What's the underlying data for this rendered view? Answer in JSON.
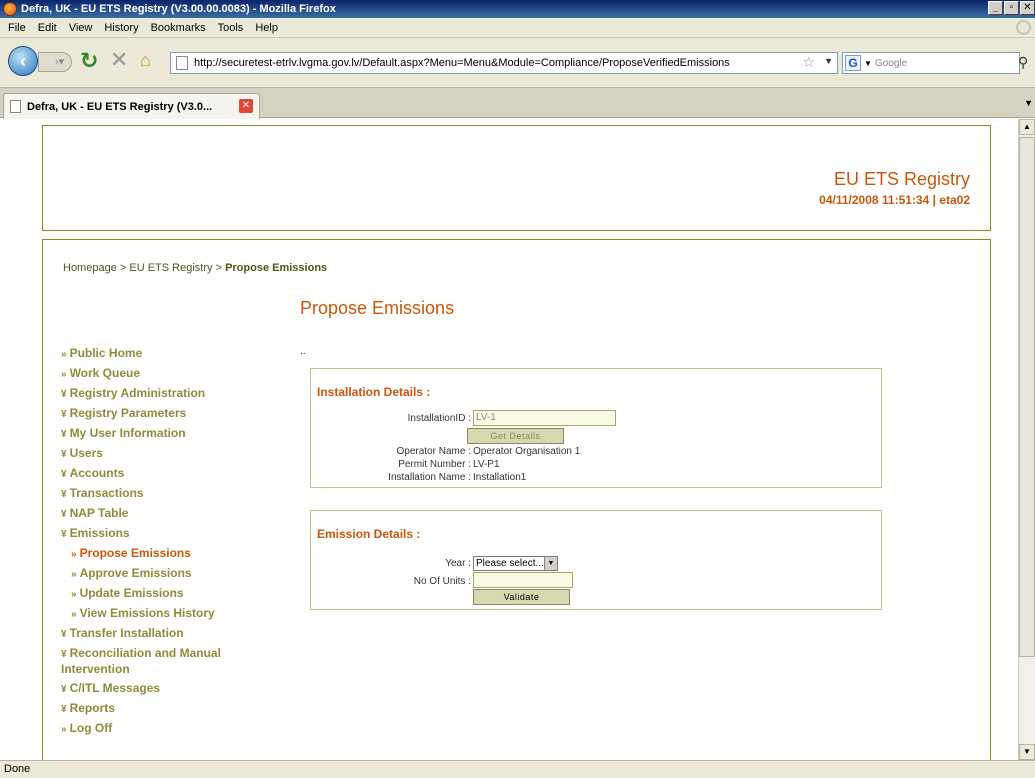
{
  "window": {
    "title": "Defra, UK - EU ETS Registry (V3.00.00.0083) - Mozilla Firefox"
  },
  "menu": [
    "File",
    "Edit",
    "View",
    "History",
    "Bookmarks",
    "Tools",
    "Help"
  ],
  "nav": {
    "url": "http://securetest-etrlv.lvgma.gov.lv/Default.aspx?Menu=Menu&Module=Compliance/ProposeVerifiedEmissions",
    "search_placeholder": "Google"
  },
  "tab": {
    "label": "Defra, UK - EU ETS Registry (V3.0..."
  },
  "status": "Done",
  "header": {
    "site_title": "EU ETS Registry",
    "datetime": "04/11/2008 11:51:34 | eta02"
  },
  "breadcrumb": {
    "items": [
      "Homepage",
      "EU ETS Registry"
    ],
    "current": "Propose Emissions",
    "separator": " > "
  },
  "page": {
    "title": "Propose Emissions",
    "dots": ".."
  },
  "sidebar": [
    {
      "label": "Public Home",
      "mark": "»",
      "sub": false,
      "active": false
    },
    {
      "label": "Work Queue",
      "mark": "»",
      "sub": false,
      "active": false
    },
    {
      "label": "Registry Administration",
      "mark": "¥",
      "sub": false,
      "active": false
    },
    {
      "label": "Registry Parameters",
      "mark": "¥",
      "sub": false,
      "active": false
    },
    {
      "label": "My User Information",
      "mark": "¥",
      "sub": false,
      "active": false
    },
    {
      "label": "Users",
      "mark": "¥",
      "sub": false,
      "active": false
    },
    {
      "label": "Accounts",
      "mark": "¥",
      "sub": false,
      "active": false
    },
    {
      "label": "Transactions",
      "mark": "¥",
      "sub": false,
      "active": false
    },
    {
      "label": "NAP Table",
      "mark": "¥",
      "sub": false,
      "active": false
    },
    {
      "label": "Emissions",
      "mark": "¥",
      "sub": false,
      "active": false
    },
    {
      "label": "Propose Emissions",
      "mark": "»",
      "sub": true,
      "active": true
    },
    {
      "label": "Approve Emissions",
      "mark": "»",
      "sub": true,
      "active": false
    },
    {
      "label": "Update Emissions",
      "mark": "»",
      "sub": true,
      "active": false
    },
    {
      "label": "View Emissions History",
      "mark": "»",
      "sub": true,
      "active": false
    },
    {
      "label": "Transfer Installation",
      "mark": "¥",
      "sub": false,
      "active": false
    },
    {
      "label": "Reconciliation and Manual Intervention",
      "mark": "¥",
      "sub": false,
      "active": false,
      "wrap": true
    },
    {
      "label": "C/ITL Messages",
      "mark": "¥",
      "sub": false,
      "active": false
    },
    {
      "label": "Reports",
      "mark": "¥",
      "sub": false,
      "active": false
    },
    {
      "label": "Log Off",
      "mark": "»",
      "sub": false,
      "active": false
    }
  ],
  "installation": {
    "heading": "Installation Details :",
    "id_label": "InstallationID :",
    "id_value": "LV-1",
    "get_details": "Get Details",
    "operator_label": "Operator Name :",
    "operator_value": "Operator Organisation 1",
    "permit_label": "Permit Number :",
    "permit_value": "LV-P1",
    "name_label": "Installation Name :",
    "name_value": "Installation1"
  },
  "emission": {
    "heading": "Emission Details :",
    "year_label": "Year :",
    "year_value": "Please select...",
    "units_label": "No Of Units :",
    "units_value": "",
    "validate": "Validate"
  }
}
